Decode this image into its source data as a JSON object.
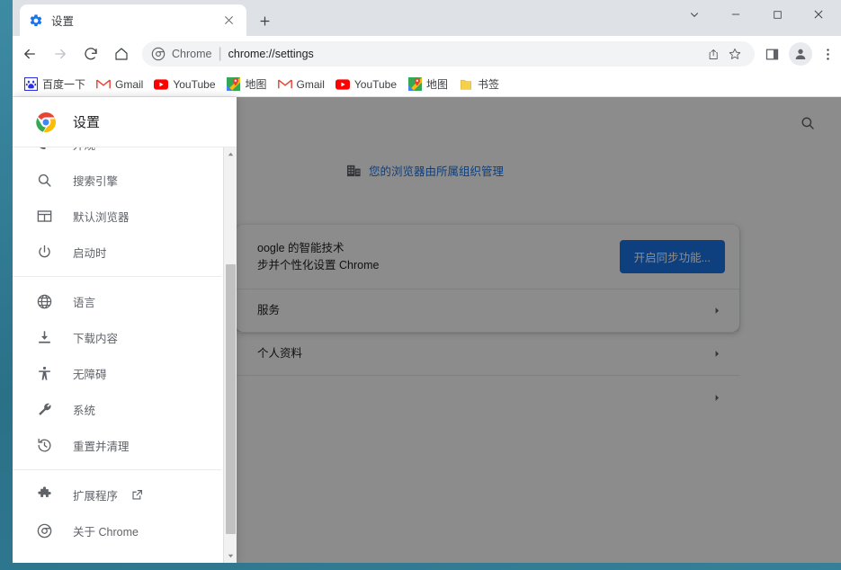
{
  "window": {
    "controls": {
      "chevron": "chevron-down",
      "minimize": "minimize",
      "maximize": "maximize",
      "close": "close"
    }
  },
  "tab": {
    "title": "设置",
    "favicon": "settings-gear-icon",
    "close_label": "×",
    "newtab_label": "+"
  },
  "toolbar": {
    "back": "←",
    "forward": "→",
    "reload": "⟳",
    "home": "⌂",
    "omnibox": {
      "site_icon": "chrome-icon",
      "site_label": "Chrome",
      "separator": "|",
      "url": "chrome://settings",
      "share_icon": "share-icon",
      "bookmark_icon": "star-icon"
    },
    "side_panel_icon": "side-panel-icon",
    "avatar_icon": "profile-avatar-icon",
    "menu_icon": "three-dot-menu-icon"
  },
  "bookmarks": [
    {
      "label": "百度一下",
      "icon": "baidu-icon"
    },
    {
      "label": "Gmail",
      "icon": "gmail-icon"
    },
    {
      "label": "YouTube",
      "icon": "youtube-icon"
    },
    {
      "label": "地图",
      "icon": "maps-icon"
    },
    {
      "label": "Gmail",
      "icon": "gmail-icon"
    },
    {
      "label": "YouTube",
      "icon": "youtube-icon"
    },
    {
      "label": "地图",
      "icon": "maps-icon"
    },
    {
      "label": "书签",
      "icon": "folder-icon"
    }
  ],
  "page": {
    "search_icon": "search-icon",
    "managed_banner": {
      "icon": "building-icon",
      "text": "您的浏览器由所属组织管理"
    },
    "card": {
      "sync_row": {
        "title": "oogle 的智能技术",
        "subtitle": "步并个性化设置 Chrome",
        "button_label": "开启同步功能..."
      },
      "nav_rows": [
        {
          "label": "服务",
          "arrow": "chevron-right-icon"
        },
        {
          "label": "个人资料",
          "arrow": "chevron-right-icon"
        },
        {
          "label": "",
          "arrow": "chevron-right-icon"
        }
      ]
    }
  },
  "drawer": {
    "header": {
      "logo": "chrome-logo-icon",
      "title": "设置"
    },
    "items": [
      {
        "label": "外观",
        "icon": "appearance-icon",
        "partial": true
      },
      {
        "label": "搜索引擎",
        "icon": "search-icon"
      },
      {
        "label": "默认浏览器",
        "icon": "browser-window-icon"
      },
      {
        "label": "启动时",
        "icon": "power-icon"
      },
      {
        "separator": true
      },
      {
        "label": "语言",
        "icon": "globe-icon"
      },
      {
        "label": "下载内容",
        "icon": "download-icon"
      },
      {
        "label": "无障碍",
        "icon": "accessibility-icon"
      },
      {
        "label": "系统",
        "icon": "wrench-icon"
      },
      {
        "label": "重置并清理",
        "icon": "history-restore-icon"
      },
      {
        "separator": true
      },
      {
        "label": "扩展程序",
        "icon": "puzzle-icon",
        "external": "external-link-icon"
      },
      {
        "label": "关于 Chrome",
        "icon": "chrome-outline-icon"
      }
    ],
    "scrollbar": {
      "up": "▲",
      "down": "▼"
    }
  },
  "colors": {
    "accent": "#1a73e8",
    "tabstrip": "#dee1e6",
    "text": "#202124",
    "muted": "#5f6368",
    "desktop": "#2e7d95"
  }
}
